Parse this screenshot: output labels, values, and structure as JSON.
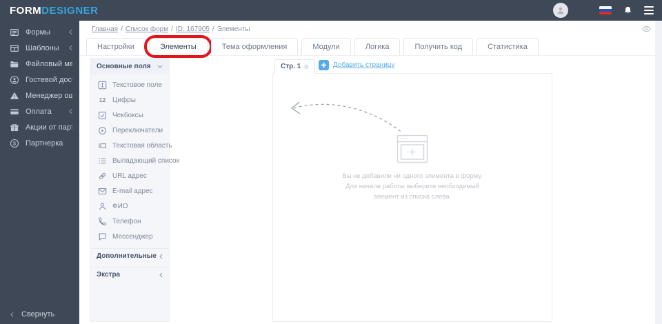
{
  "topbar": {
    "logo_primary": "FORM",
    "logo_secondary": "DESIGNER"
  },
  "nav": {
    "items": [
      {
        "label": "Формы",
        "icon": "forms-icon",
        "has_chevron": true
      },
      {
        "label": "Шаблоны",
        "icon": "templates-icon",
        "has_chevron": true
      },
      {
        "label": "Файловый менеджер",
        "icon": "file-manager-icon",
        "has_chevron": false
      },
      {
        "label": "Гостевой доступ",
        "icon": "guest-access-icon",
        "has_chevron": false
      },
      {
        "label": "Менеджер ошибок",
        "icon": "error-manager-icon",
        "has_chevron": false
      },
      {
        "label": "Оплата",
        "icon": "payment-icon",
        "has_chevron": true
      },
      {
        "label": "Акции от партнеров",
        "icon": "partner-promos-icon",
        "has_chevron": false
      },
      {
        "label": "Партнерка",
        "icon": "affiliate-icon",
        "has_chevron": false
      }
    ],
    "collapse_label": "Свернуть"
  },
  "breadcrumb": {
    "separator": "/",
    "links": [
      "Главная",
      "Список форм",
      "ID: 167905"
    ],
    "current": "Элементы"
  },
  "tabs": [
    "Настройки",
    "Элементы",
    "Тема оформления",
    "Модули",
    "Логика",
    "Получить код",
    "Статистика"
  ],
  "fields_panel": {
    "primary_section": {
      "label": "Основные поля"
    },
    "items": [
      {
        "label": "Текстовое поле",
        "icon": "text-field-icon"
      },
      {
        "label": "Цифры",
        "icon": "numbers-icon",
        "icon_text": "12"
      },
      {
        "label": "Чекбоксы",
        "icon": "checkbox-icon"
      },
      {
        "label": "Переключатели",
        "icon": "radio-icon"
      },
      {
        "label": "Текстовая область",
        "icon": "textarea-icon"
      },
      {
        "label": "Выпадающий список",
        "icon": "dropdown-list-icon"
      },
      {
        "label": "URL адрес",
        "icon": "url-icon"
      },
      {
        "label": "E-mail адрес",
        "icon": "email-icon"
      },
      {
        "label": "ФИО",
        "icon": "person-icon"
      },
      {
        "label": "Телефон",
        "icon": "phone-icon"
      },
      {
        "label": "Мессенджер",
        "icon": "messenger-icon"
      }
    ],
    "secondary_sections": [
      {
        "label": "Дополнительные"
      },
      {
        "label": "Экстра"
      }
    ]
  },
  "canvas": {
    "page_tab": "Стр. 1",
    "add_page": "Добавить страницу",
    "empty_state": {
      "line1": "Вы не добавили ни одного элемента в форму.",
      "line2": "Для начала работы выберите необходимый",
      "line3": "элемент из списка слева."
    }
  },
  "colors": {
    "topbar_bg": "#3f4857",
    "logo_accent": "#35a3dd",
    "link_blue": "#55ace6",
    "annotation_red": "#e2141c",
    "panel_bg": "#f5f6fa"
  }
}
